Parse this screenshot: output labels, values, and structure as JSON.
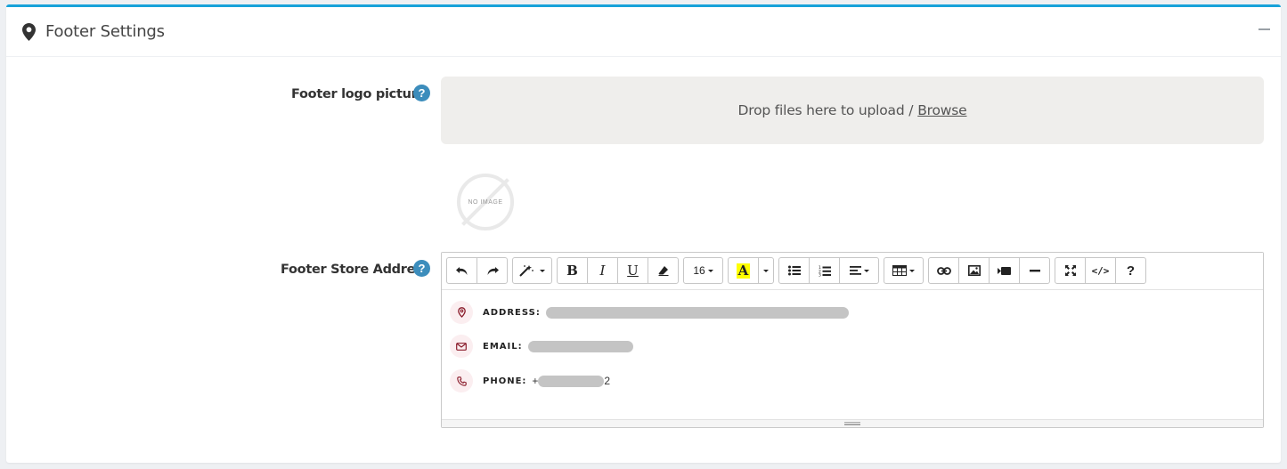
{
  "card": {
    "title": "Footer Settings",
    "title_icon": "map-pin-icon",
    "collapse_icon": "minus-icon",
    "accent_color": "#17a2d9"
  },
  "logo_field": {
    "label": "Footer logo picture",
    "help": "?",
    "dropzone_text": "Drop files here to upload /",
    "browse_text": "Browse",
    "placeholder_image_text": "NO IMAGE"
  },
  "address_field": {
    "label": "Footer Store Address",
    "help": "?",
    "toolbar": {
      "font_size": "16",
      "groups": [
        [
          "undo-icon",
          "redo-icon"
        ],
        [
          "magic-wand-style-icon"
        ],
        [
          "bold-icon",
          "italic-icon",
          "underline-icon",
          "eraser-icon"
        ],
        [
          "font-size-dropdown"
        ],
        [
          "text-color-icon",
          "color-dropdown-caret"
        ],
        [
          "unordered-list-icon",
          "ordered-list-icon",
          "paragraph-align-icon"
        ],
        [
          "table-icon"
        ],
        [
          "link-icon",
          "picture-icon",
          "video-icon",
          "horizontal-rule-icon"
        ],
        [
          "fullscreen-icon",
          "code-view-icon",
          "help-icon"
        ]
      ],
      "text_color_highlight": "#ffff00"
    },
    "content": {
      "address_label": "ADDRESS:",
      "email_label": "EMAIL:",
      "phone_label": "PHONE:",
      "phone_prefix": "+",
      "phone_suffix": "2",
      "icon_color": "#8a1c2b"
    }
  }
}
